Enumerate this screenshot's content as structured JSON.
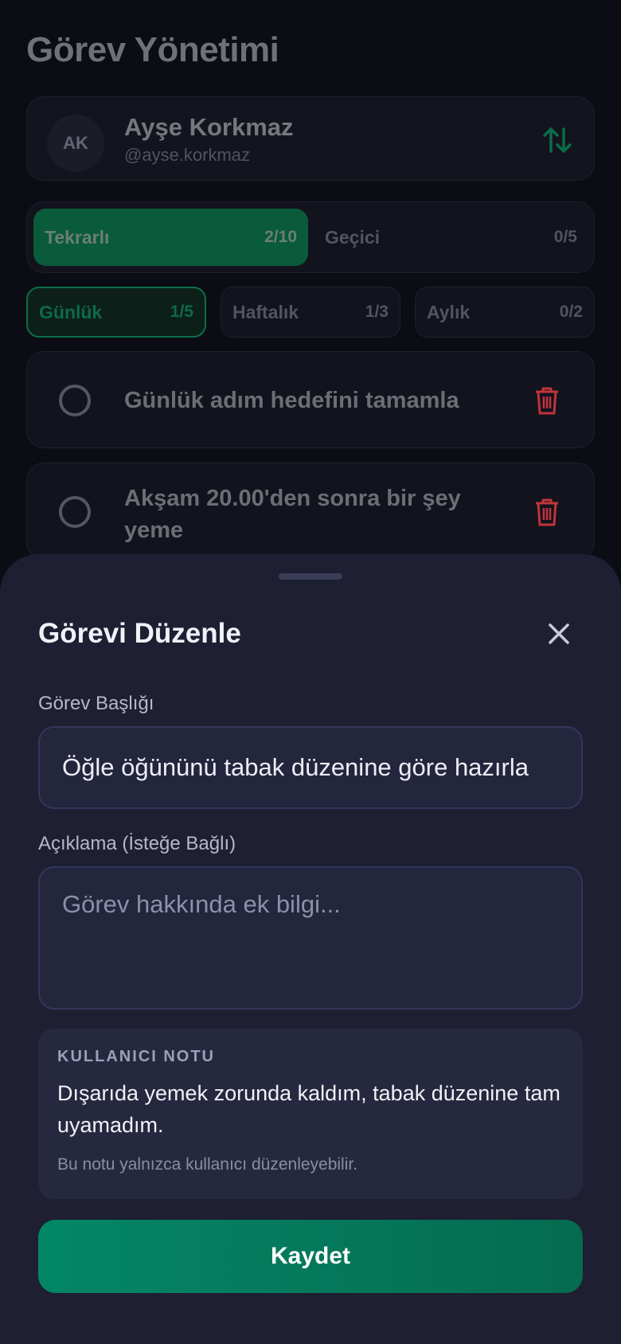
{
  "page": {
    "title": "Görev Yönetimi"
  },
  "user": {
    "initials": "AK",
    "name": "Ayşe Korkmaz",
    "handle": "@ayse.korkmaz"
  },
  "type_tabs": [
    {
      "label": "Tekrarlı",
      "count": "2/10",
      "active": true
    },
    {
      "label": "Geçici",
      "count": "0/5",
      "active": false
    }
  ],
  "period_tabs": [
    {
      "label": "Günlük",
      "count": "1/5",
      "active": true
    },
    {
      "label": "Haftalık",
      "count": "1/3",
      "active": false
    },
    {
      "label": "Aylık",
      "count": "0/2",
      "active": false
    }
  ],
  "tasks": [
    {
      "text": "Günlük adım hedefini tamamla"
    },
    {
      "text": "Akşam 20.00'den sonra bir şey yeme"
    }
  ],
  "sheet": {
    "title": "Görevi Düzenle",
    "title_label": "Görev Başlığı",
    "title_value": "Öğle öğününü tabak düzenine göre hazırla",
    "desc_label": "Açıklama (İsteğe Bağlı)",
    "desc_placeholder": "Görev hakkında ek bilgi...",
    "note_label": "KULLANICI NOTU",
    "note_text": "Dışarıda yemek zorunda kaldım, tabak düzenine tam uyamadım.",
    "note_hint": "Bu notu yalnızca kullanıcı düzenleyebilir.",
    "save_label": "Kaydet"
  },
  "colors": {
    "accent": "#038766",
    "danger": "#c0343b",
    "sheet_bg": "#1e1f33"
  }
}
